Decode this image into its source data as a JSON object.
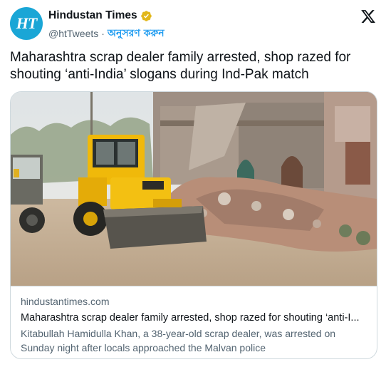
{
  "author": {
    "avatar_text": "HT",
    "display_name": "Hindustan Times",
    "handle": "@htTweets",
    "separator": "·",
    "follow_label": "অনুসরণ করুন"
  },
  "tweet": {
    "text": "Maharashtra scrap dealer family arrested, shop razed for shouting ‘anti-India’ slogans during Ind-Pak match"
  },
  "card": {
    "domain": "hindustantimes.com",
    "title": "Maharashtra scrap dealer family arrested, shop razed for shouting ‘anti-I...",
    "description": "Kitabullah Hamidulla Khan, a 38-year-old scrap dealer, was arrested on Sunday night after locals approached the Malvan police"
  },
  "icons": {
    "verified": "verified-badge-icon",
    "platform": "x-logo-icon"
  },
  "colors": {
    "accent": "#1d9bf0",
    "verified_gold": "#e2b719",
    "avatar_bg": "#1aa6d6"
  }
}
